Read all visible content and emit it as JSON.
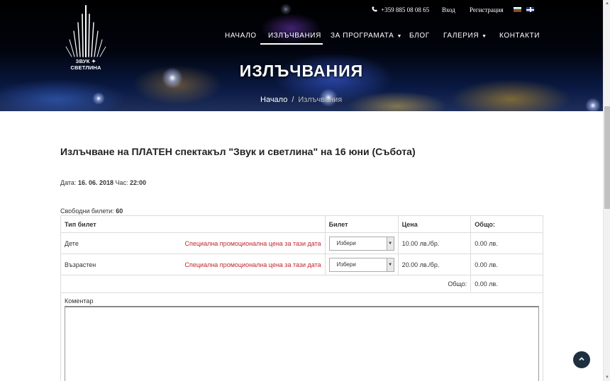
{
  "header": {
    "logo_text": "ЗВУК ✦ СВЕТЛИНА",
    "phone": "+359 885 08 08 65",
    "login_label": "Вход",
    "register_label": "Регистрация",
    "phone_icon": "phone-icon",
    "languages": [
      "bg-flag-icon",
      "en-flag-icon"
    ]
  },
  "nav": {
    "items": [
      {
        "label": "НАЧАЛО"
      },
      {
        "label": "ИЗЛЪЧВАНИЯ"
      },
      {
        "label": "ЗА ПРОГРАМАТА"
      },
      {
        "label": "БЛОГ"
      },
      {
        "label": "ГАЛЕРИЯ"
      },
      {
        "label": "КОНТАКТИ"
      }
    ],
    "active": "ИЗЛЪЧВАНИЯ",
    "dropdown_icon": "chevron-down-icon"
  },
  "hero": {
    "title": "ИЗЛЪЧВАНИЯ",
    "breadcrumb": {
      "home": "Начало",
      "separator": "/",
      "current": "Излъчвания"
    }
  },
  "event": {
    "title": "Излъчване на ПЛАТЕН спектакъл \"Звук и светлина\" на 16 юни (Събота)",
    "date_label": "Дата:",
    "date_value": "16. 06. 2018",
    "time_label": "Час:",
    "time_value": "22:00",
    "free_label": "Свободни билети:",
    "free_value": "60"
  },
  "table": {
    "headers": {
      "type": "Тип билет",
      "ticket": "Билет",
      "price": "Цена",
      "total": "Общо:"
    },
    "rows": [
      {
        "type": "Дете",
        "promo": "Специална промоционална цена за тази дата",
        "select": "Избери",
        "price": "10.00 лв./бр.",
        "total": "0.00 лв."
      },
      {
        "type": "Възрастен",
        "promo": "Специална промоционална цена за тази дата",
        "select": "Избери",
        "price": "20.00 лв./бр.",
        "total": "0.00 лв."
      }
    ],
    "sum_label": "Общо:",
    "sum_value": "0.00 лв."
  },
  "comment": {
    "label": "Коментар",
    "value": ""
  },
  "colors": {
    "promo": "#c0282d",
    "to_top_bg": "#1e2f3f"
  }
}
